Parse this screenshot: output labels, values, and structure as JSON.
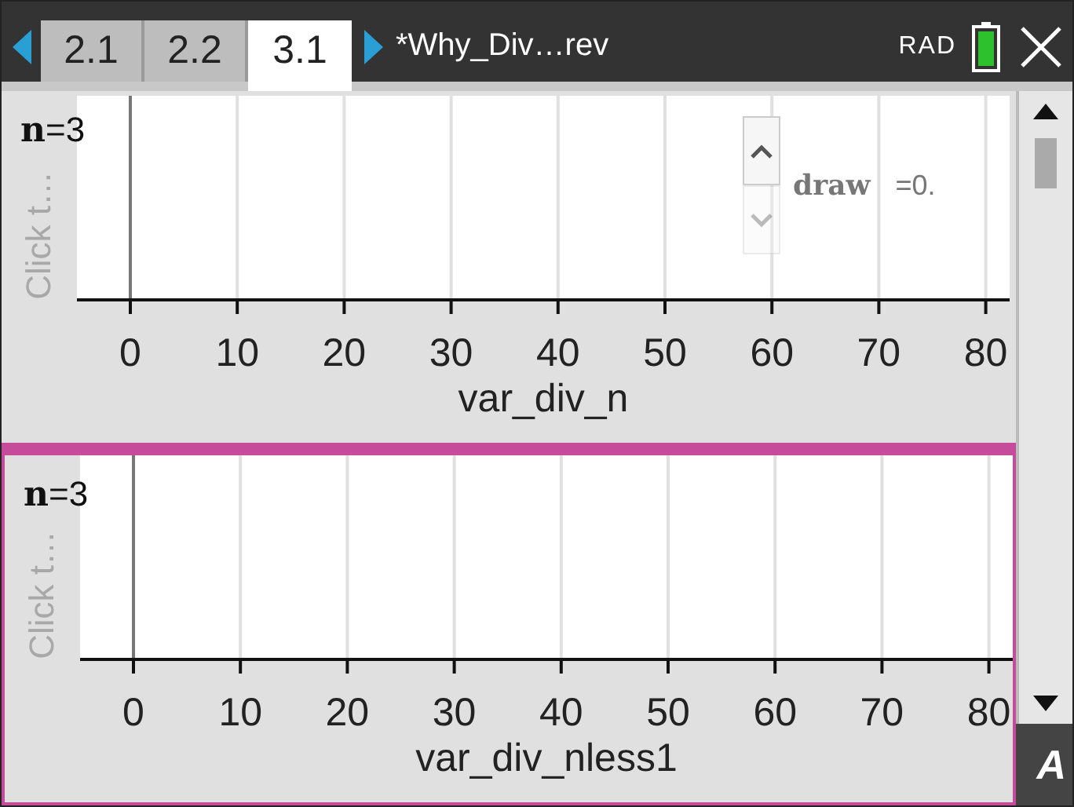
{
  "tabs": [
    {
      "label": "2.1",
      "selected": false
    },
    {
      "label": "2.2",
      "selected": false
    },
    {
      "label": "3.1",
      "selected": true
    }
  ],
  "document_title": "*Why_Div…rev",
  "angle_mode": "RAD",
  "panels": [
    {
      "selected": false,
      "side_label": "Click t…",
      "variable": "**n**=3",
      "slider": {
        "name": "draw",
        "value": "=0.",
        "up_disabled": false,
        "down_disabled": true
      },
      "axis": {
        "title": "var_div_n",
        "ticks": [
          "0",
          "10",
          "20",
          "30",
          "40",
          "50",
          "60",
          "70",
          "80"
        ]
      }
    },
    {
      "selected": true,
      "side_label": "Click t…",
      "variable": "**n**=3",
      "axis": {
        "title": "var_div_nless1",
        "ticks": [
          "0",
          "10",
          "20",
          "30",
          "40",
          "50",
          "60",
          "70",
          "80"
        ]
      }
    }
  ],
  "corner_button": "A"
}
